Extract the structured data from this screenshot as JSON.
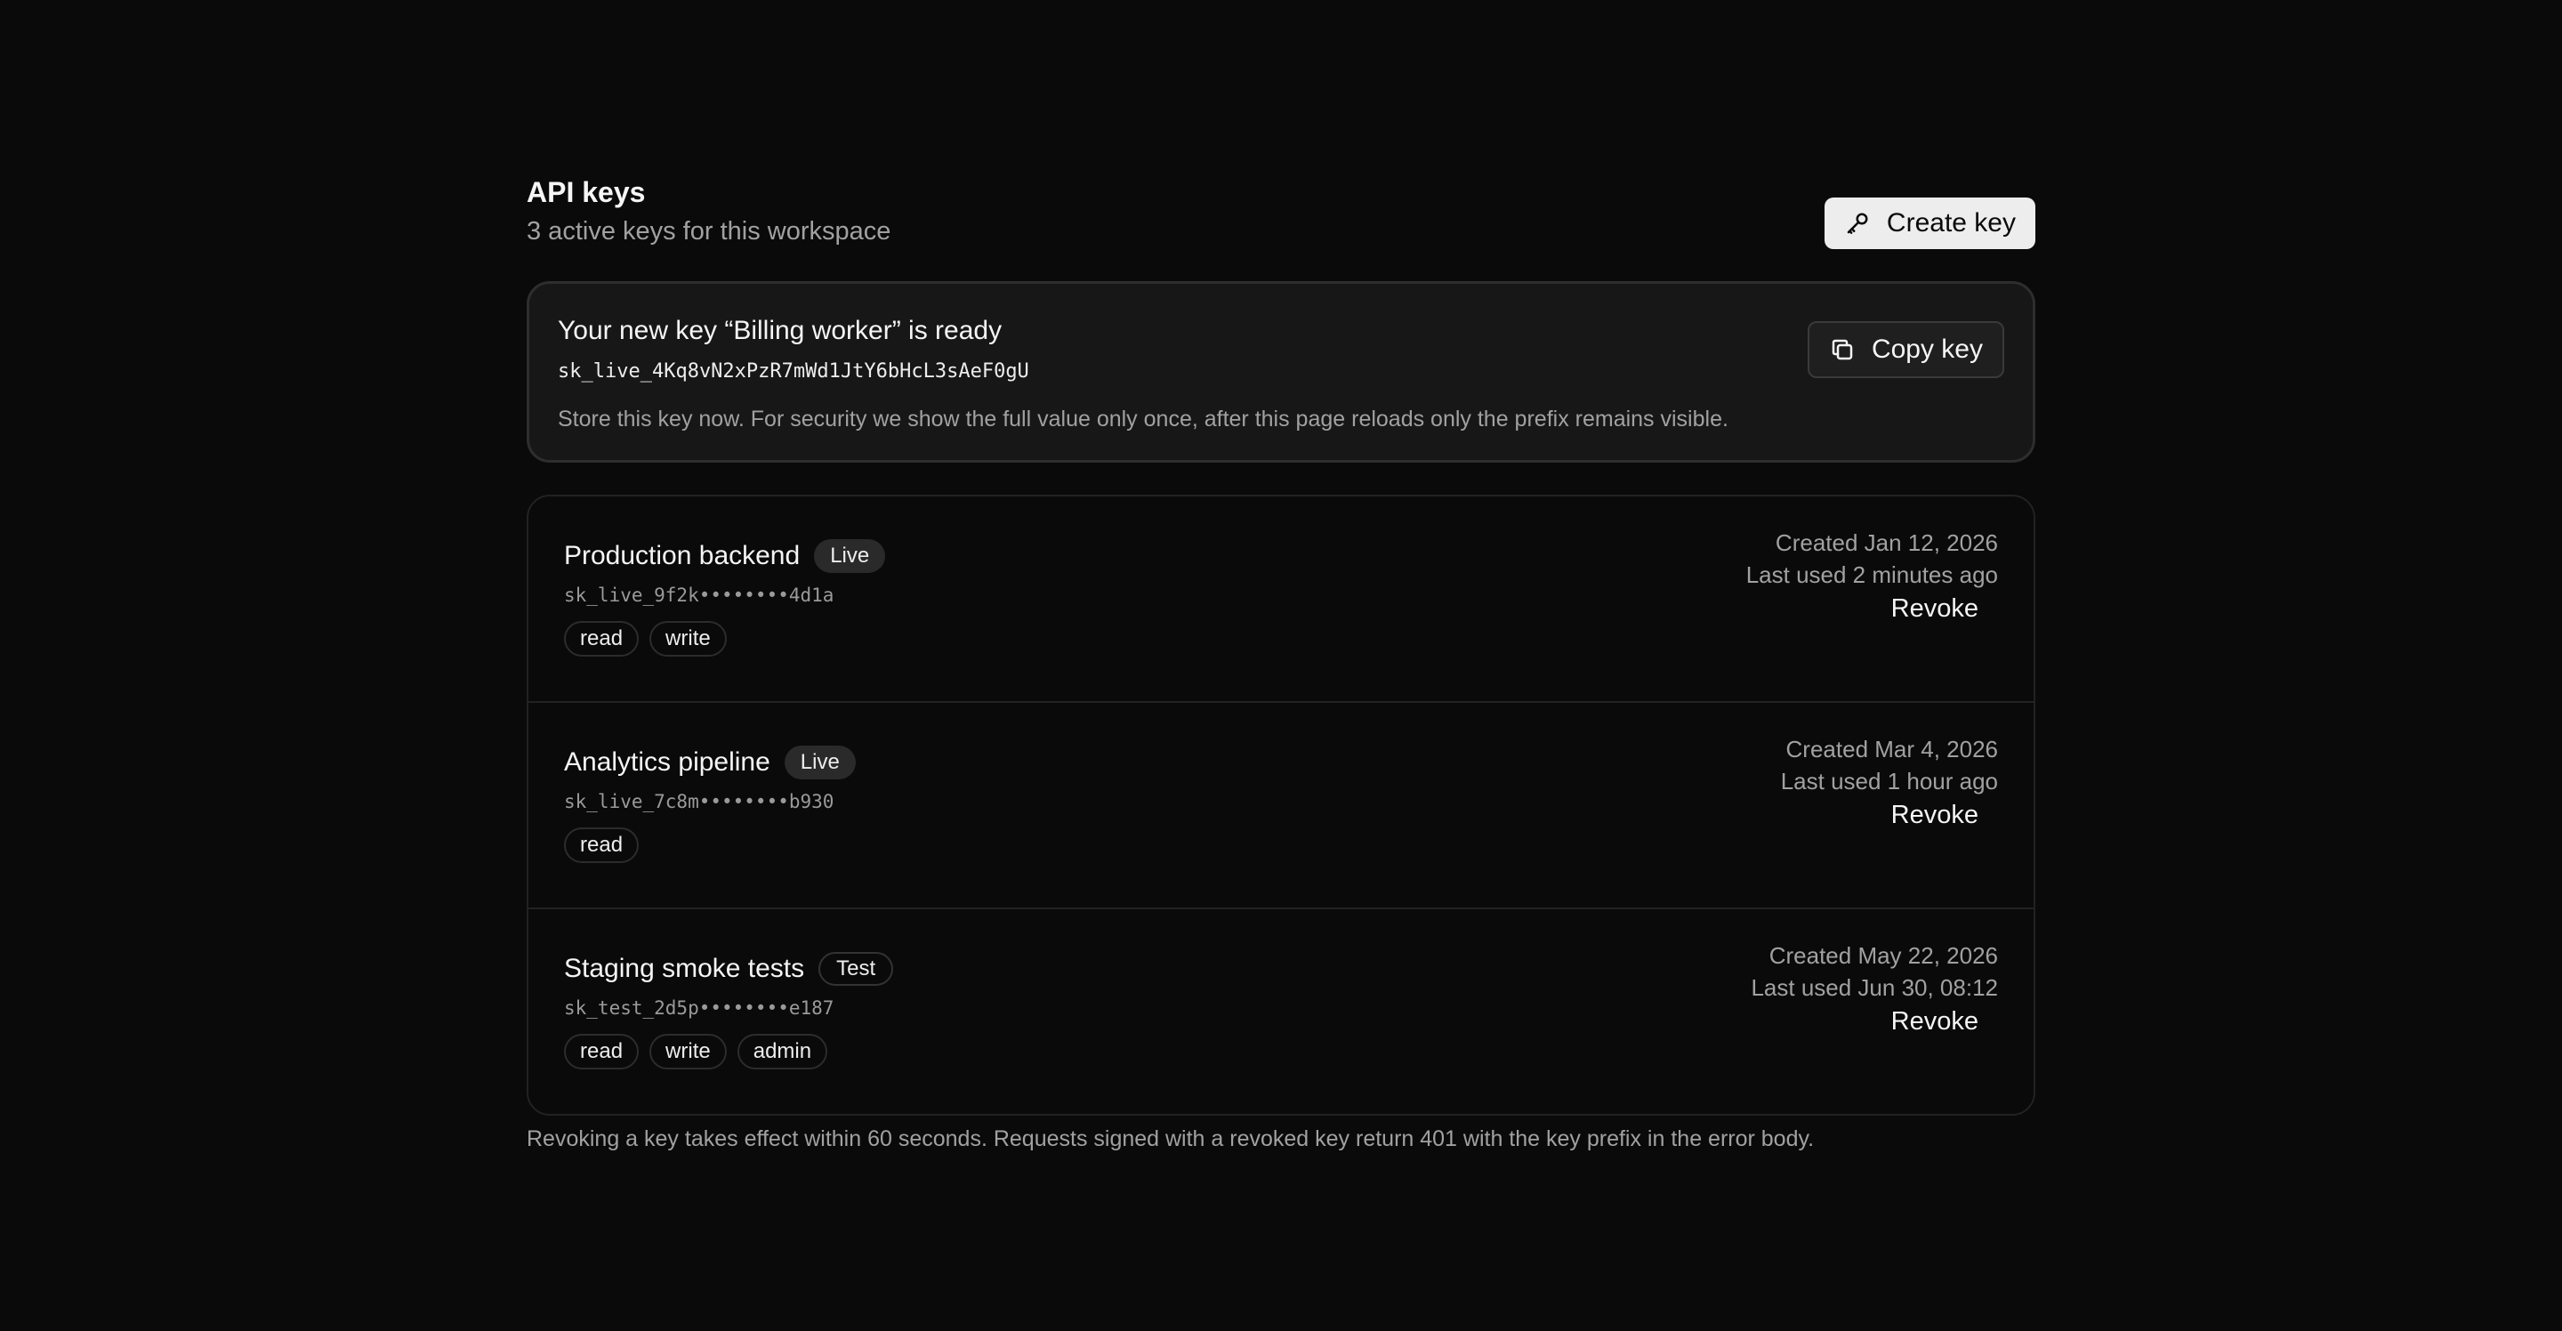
{
  "header": {
    "title": "API keys",
    "subtitle": "3 active keys for this workspace",
    "create_label": "Create key"
  },
  "banner": {
    "title": "Your new key “Billing worker” is ready",
    "key_value": "sk_live_4Kq8vN2xPzR7mWd1JtY6bHcL3sAeF0gU",
    "note": "Store this key now. For security we show the full value only once, after this page reloads only the prefix remains visible.",
    "copy_label": "Copy key"
  },
  "keys": [
    {
      "name": "Production backend",
      "env": "Live",
      "prefix": "sk_live_9f2k••••••••4d1a",
      "scopes": [
        "read",
        "write"
      ],
      "created": "Created Jan 12, 2026",
      "last_used": "Last used 2 minutes ago",
      "action": "Revoke"
    },
    {
      "name": "Analytics pipeline",
      "env": "Live",
      "prefix": "sk_live_7c8m••••••••b930",
      "scopes": [
        "read"
      ],
      "created": "Created Mar 4, 2026",
      "last_used": "Last used 1 hour ago",
      "action": "Revoke"
    },
    {
      "name": "Staging smoke tests",
      "env": "Test",
      "prefix": "sk_test_2d5p••••••••e187",
      "scopes": [
        "read",
        "write",
        "admin"
      ],
      "created": "Created May 22, 2026",
      "last_used": "Last used Jun 30, 08:12",
      "action": "Revoke"
    }
  ],
  "footer_note": "Revoking a key takes effect within 60 seconds. Requests signed with a revoked key return 401 with the key prefix in the error body.",
  "colors": {
    "background": "#0a0a0a",
    "surface": "#171717",
    "border": "#222222",
    "primary_button": "#ededed",
    "muted_text": "#a1a1a1"
  },
  "icons": {
    "create": "key-icon",
    "copy": "copy-icon"
  }
}
